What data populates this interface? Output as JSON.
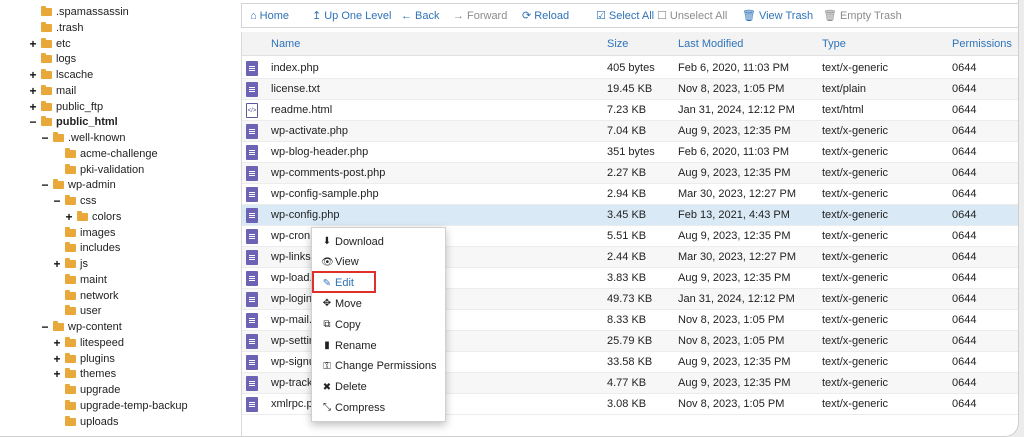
{
  "tree": [
    {
      "label": ".spamassassin",
      "toggle": "",
      "depth": 0,
      "bold": false
    },
    {
      "label": ".trash",
      "toggle": "",
      "depth": 0,
      "bold": false
    },
    {
      "label": "etc",
      "toggle": "+",
      "depth": 0,
      "bold": false
    },
    {
      "label": "logs",
      "toggle": "",
      "depth": 0,
      "bold": false
    },
    {
      "label": "lscache",
      "toggle": "+",
      "depth": 0,
      "bold": false
    },
    {
      "label": "mail",
      "toggle": "+",
      "depth": 0,
      "bold": false
    },
    {
      "label": "public_ftp",
      "toggle": "+",
      "depth": 0,
      "bold": false
    },
    {
      "label": "public_html",
      "toggle": "−",
      "depth": 0,
      "bold": true
    },
    {
      "label": ".well-known",
      "toggle": "−",
      "depth": 1,
      "bold": false
    },
    {
      "label": "acme-challenge",
      "toggle": "",
      "depth": 2,
      "bold": false
    },
    {
      "label": "pki-validation",
      "toggle": "",
      "depth": 2,
      "bold": false
    },
    {
      "label": "wp-admin",
      "toggle": "−",
      "depth": 1,
      "bold": false
    },
    {
      "label": "css",
      "toggle": "−",
      "depth": 2,
      "bold": false
    },
    {
      "label": "colors",
      "toggle": "+",
      "depth": 3,
      "bold": false
    },
    {
      "label": "images",
      "toggle": "",
      "depth": 2,
      "bold": false
    },
    {
      "label": "includes",
      "toggle": "",
      "depth": 2,
      "bold": false
    },
    {
      "label": "js",
      "toggle": "+",
      "depth": 2,
      "bold": false
    },
    {
      "label": "maint",
      "toggle": "",
      "depth": 2,
      "bold": false
    },
    {
      "label": "network",
      "toggle": "",
      "depth": 2,
      "bold": false
    },
    {
      "label": "user",
      "toggle": "",
      "depth": 2,
      "bold": false
    },
    {
      "label": "wp-content",
      "toggle": "−",
      "depth": 1,
      "bold": false
    },
    {
      "label": "litespeed",
      "toggle": "+",
      "depth": 2,
      "bold": false
    },
    {
      "label": "plugins",
      "toggle": "+",
      "depth": 2,
      "bold": false
    },
    {
      "label": "themes",
      "toggle": "+",
      "depth": 2,
      "bold": false
    },
    {
      "label": "upgrade",
      "toggle": "",
      "depth": 2,
      "bold": false
    },
    {
      "label": "upgrade-temp-backup",
      "toggle": "",
      "depth": 2,
      "bold": false
    },
    {
      "label": "uploads",
      "toggle": "",
      "depth": 2,
      "bold": false
    }
  ],
  "toolbar": [
    {
      "name": "home-button",
      "icon": "home-icon",
      "glyph": "⌂",
      "label": "Home",
      "disabled": false
    },
    {
      "name": "up-one-level-button",
      "icon": "up-arrow-icon",
      "glyph": "↥",
      "label": "Up One Level",
      "disabled": false
    },
    {
      "name": "back-button",
      "icon": "left-arrow-icon",
      "glyph": "←",
      "label": "Back",
      "disabled": false
    },
    {
      "name": "forward-button",
      "icon": "right-arrow-icon",
      "glyph": "→",
      "label": "Forward",
      "disabled": true
    },
    {
      "name": "reload-button",
      "icon": "reload-icon",
      "glyph": "⟳",
      "label": "Reload",
      "disabled": false
    },
    {
      "name": "select-all-button",
      "icon": "checked-box-icon",
      "glyph": "☑",
      "label": "Select All",
      "disabled": false
    },
    {
      "name": "unselect-all-button",
      "icon": "empty-box-icon",
      "glyph": "☐",
      "label": "Unselect All",
      "disabled": true
    },
    {
      "name": "view-trash-button",
      "icon": "trash-icon",
      "glyph": "🗑",
      "label": "View Trash",
      "disabled": false
    },
    {
      "name": "empty-trash-button",
      "icon": "trash-icon",
      "glyph": "🗑",
      "label": "Empty Trash",
      "disabled": true
    }
  ],
  "columns": {
    "name": "Name",
    "size": "Size",
    "modified": "Last Modified",
    "type": "Type",
    "permissions": "Permissions"
  },
  "files": [
    {
      "name": "index.php",
      "size": "405 bytes",
      "modified": "Feb 6, 2020, 11:03 PM",
      "type": "text/x-generic",
      "perm": "0644",
      "icon": "php"
    },
    {
      "name": "license.txt",
      "size": "19.45 KB",
      "modified": "Nov 8, 2023, 1:05 PM",
      "type": "text/plain",
      "perm": "0644",
      "icon": "php"
    },
    {
      "name": "readme.html",
      "size": "7.23 KB",
      "modified": "Jan 31, 2024, 12:12 PM",
      "type": "text/html",
      "perm": "0644",
      "icon": "html"
    },
    {
      "name": "wp-activate.php",
      "size": "7.04 KB",
      "modified": "Aug 9, 2023, 12:35 PM",
      "type": "text/x-generic",
      "perm": "0644",
      "icon": "php"
    },
    {
      "name": "wp-blog-header.php",
      "size": "351 bytes",
      "modified": "Feb 6, 2020, 11:03 PM",
      "type": "text/x-generic",
      "perm": "0644",
      "icon": "php"
    },
    {
      "name": "wp-comments-post.php",
      "size": "2.27 KB",
      "modified": "Aug 9, 2023, 12:35 PM",
      "type": "text/x-generic",
      "perm": "0644",
      "icon": "php"
    },
    {
      "name": "wp-config-sample.php",
      "size": "2.94 KB",
      "modified": "Mar 30, 2023, 12:27 PM",
      "type": "text/x-generic",
      "perm": "0644",
      "icon": "php"
    },
    {
      "name": "wp-config.php",
      "size": "3.45 KB",
      "modified": "Feb 13, 2021, 4:43 PM",
      "type": "text/x-generic",
      "perm": "0644",
      "icon": "php",
      "selected": true
    },
    {
      "name": "wp-cron.php",
      "size": "5.51 KB",
      "modified": "Aug 9, 2023, 12:35 PM",
      "type": "text/x-generic",
      "perm": "0644",
      "icon": "php"
    },
    {
      "name": "wp-links-opml.php",
      "size": "2.44 KB",
      "modified": "Mar 30, 2023, 12:27 PM",
      "type": "text/x-generic",
      "perm": "0644",
      "icon": "php"
    },
    {
      "name": "wp-load.php",
      "size": "3.83 KB",
      "modified": "Aug 9, 2023, 12:35 PM",
      "type": "text/x-generic",
      "perm": "0644",
      "icon": "php"
    },
    {
      "name": "wp-login.php",
      "size": "49.73 KB",
      "modified": "Jan 31, 2024, 12:12 PM",
      "type": "text/x-generic",
      "perm": "0644",
      "icon": "php"
    },
    {
      "name": "wp-mail.php",
      "size": "8.33 KB",
      "modified": "Nov 8, 2023, 1:05 PM",
      "type": "text/x-generic",
      "perm": "0644",
      "icon": "php"
    },
    {
      "name": "wp-settings.php",
      "size": "25.79 KB",
      "modified": "Nov 8, 2023, 1:05 PM",
      "type": "text/x-generic",
      "perm": "0644",
      "icon": "php"
    },
    {
      "name": "wp-signup.php",
      "size": "33.58 KB",
      "modified": "Aug 9, 2023, 12:35 PM",
      "type": "text/x-generic",
      "perm": "0644",
      "icon": "php"
    },
    {
      "name": "wp-trackback.php",
      "size": "4.77 KB",
      "modified": "Aug 9, 2023, 12:35 PM",
      "type": "text/x-generic",
      "perm": "0644",
      "icon": "php"
    },
    {
      "name": "xmlrpc.php",
      "size": "3.08 KB",
      "modified": "Nov 8, 2023, 1:05 PM",
      "type": "text/x-generic",
      "perm": "0644",
      "icon": "php"
    }
  ],
  "context_menu": [
    {
      "name": "download",
      "icon": "download-icon",
      "glyph": "⬇",
      "label": "Download"
    },
    {
      "name": "view",
      "icon": "eye-icon",
      "glyph": "👁",
      "label": "View"
    },
    {
      "name": "edit",
      "icon": "pencil-icon",
      "glyph": "✎",
      "label": "Edit"
    },
    {
      "name": "move",
      "icon": "move-arrows-icon",
      "glyph": "✥",
      "label": "Move"
    },
    {
      "name": "copy",
      "icon": "copy-icon",
      "glyph": "⧉",
      "label": "Copy"
    },
    {
      "name": "rename",
      "icon": "file-icon",
      "glyph": "▮",
      "label": "Rename"
    },
    {
      "name": "change-permissions",
      "icon": "key-icon",
      "glyph": "⚿",
      "label": "Change Permissions"
    },
    {
      "name": "delete",
      "icon": "x-icon",
      "glyph": "✖",
      "label": "Delete"
    },
    {
      "name": "compress",
      "icon": "compress-icon",
      "glyph": "⤡",
      "label": "Compress"
    }
  ],
  "colors": {
    "accent": "#2f73b8",
    "folder": "#e8a93a",
    "file_icon": "#6c63b4",
    "selected_row": "#d9eaf6",
    "highlight_box": "#e0302a"
  }
}
